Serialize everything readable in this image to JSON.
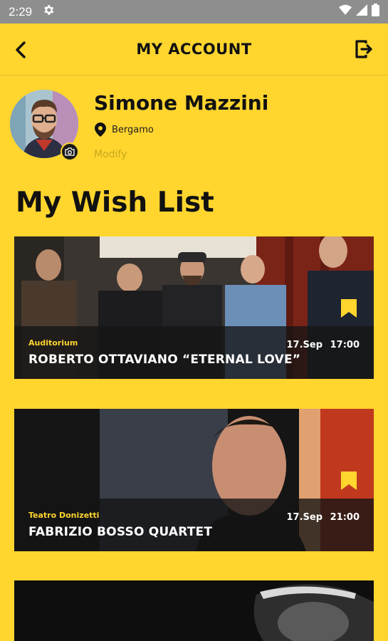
{
  "status_bar": {
    "time": "2:29"
  },
  "header": {
    "title": "MY ACCOUNT"
  },
  "profile": {
    "name": "Simone Mazzini",
    "location": "Bergamo",
    "modify_label": "Modify"
  },
  "wishlist": {
    "title": "My Wish List",
    "items": [
      {
        "venue": "Auditorium",
        "title": "ROBERTO OTTAVIANO “ETERNAL LOVE”",
        "date": "17.Sep",
        "time": "17:00"
      },
      {
        "venue": "Teatro Donizetti",
        "title": "FABRIZIO BOSSO QUARTET",
        "date": "17.Sep",
        "time": "21:00"
      }
    ]
  },
  "icons": [
    "settings-icon",
    "wifi-icon",
    "signal-icon",
    "battery-icon",
    "back-arrow-icon",
    "logout-icon",
    "camera-icon",
    "location-pin-icon",
    "bookmark-icon"
  ],
  "colors": {
    "accent": "#FFD52E",
    "text": "#111111",
    "muted": "#C8A81C"
  }
}
